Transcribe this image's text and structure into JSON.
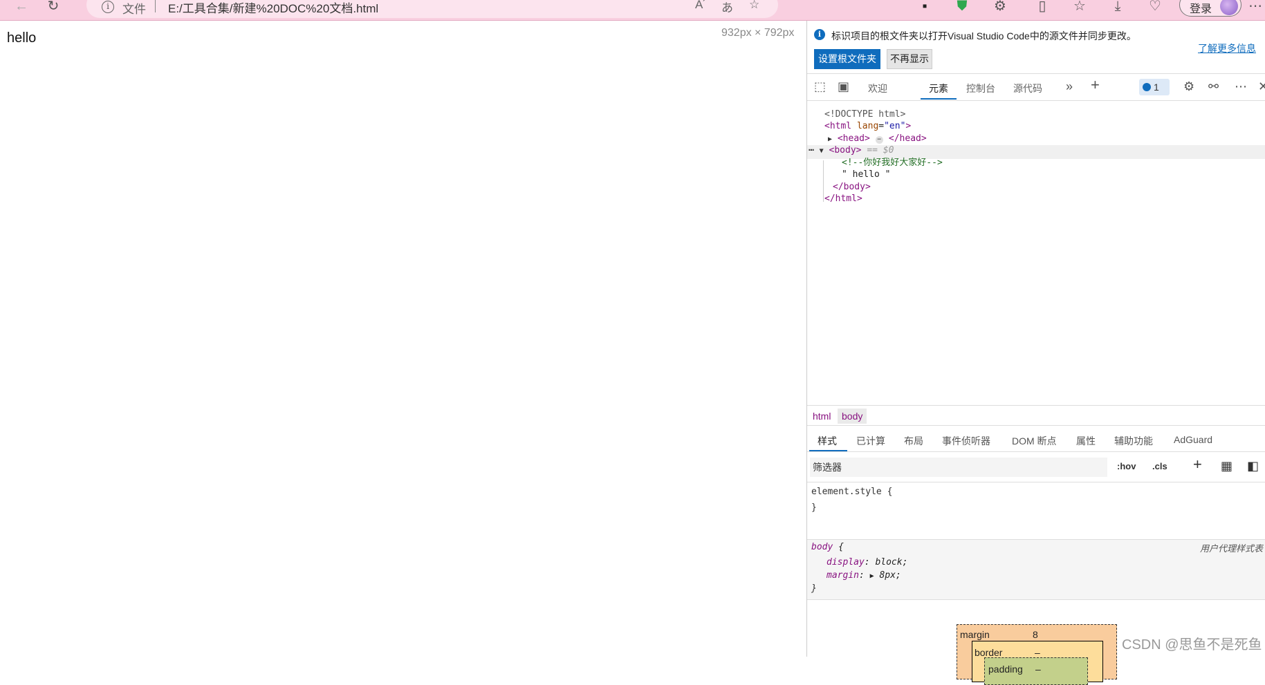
{
  "browser": {
    "address_file_label": "文件",
    "url": "E:/工具合集/新建%20DOC%20文档.html",
    "login_label": "登录"
  },
  "page": {
    "body_text": "hello",
    "viewport_size": "932px × 792px"
  },
  "devtools": {
    "banner": {
      "message": "标识项目的根文件夹以打开Visual Studio Code中的源文件并同步更改。",
      "learn_more": "了解更多信息",
      "set_root_button": "设置根文件夹",
      "dont_show_button": "不再显示"
    },
    "tabs": [
      "欢迎",
      "元素",
      "控制台",
      "源代码"
    ],
    "active_tab": "元素",
    "issues_count": "1",
    "dom": {
      "doctype": "<!DOCTYPE html>",
      "html_open_tag": "<html",
      "html_attr_name": "lang",
      "html_attr_value": "\"en\"",
      "head_open": "<head>",
      "head_close": "</head>",
      "body_open": "<body>",
      "body_selected_ref": "== $0",
      "comment": "<!--你好我好大家好-->",
      "text_node": "\" hello \"",
      "body_close": "</body>",
      "html_close": "</html>"
    },
    "breadcrumbs": [
      "html",
      "body"
    ],
    "styles_tabs": [
      "样式",
      "已计算",
      "布局",
      "事件侦听器",
      "DOM 断点",
      "属性",
      "辅助功能",
      "AdGuard"
    ],
    "filter_placeholder": "筛选器",
    "filter_buttons": {
      "hov": ":hov",
      "cls": ".cls"
    },
    "styles": {
      "element_style_open": "element.style {",
      "element_style_close": "}",
      "rule_selector": "body",
      "rule_open": "{",
      "user_agent_label": "用户代理样式表",
      "declarations": [
        {
          "prop": "display",
          "value": "block;"
        },
        {
          "prop": "margin",
          "value": "8px;"
        }
      ],
      "rule_close": "}"
    },
    "box_model": {
      "margin_label": "margin",
      "margin_value": "8",
      "border_label": "border",
      "border_value": "–",
      "padding_label": "padding",
      "padding_value": "–"
    }
  },
  "watermark": "CSDN @思鱼不是死鱼",
  "colors": {
    "toolbar_bg": "#f9cfe0",
    "accent": "#0f6cbd",
    "tag": "#881280",
    "comment": "#236e25"
  }
}
